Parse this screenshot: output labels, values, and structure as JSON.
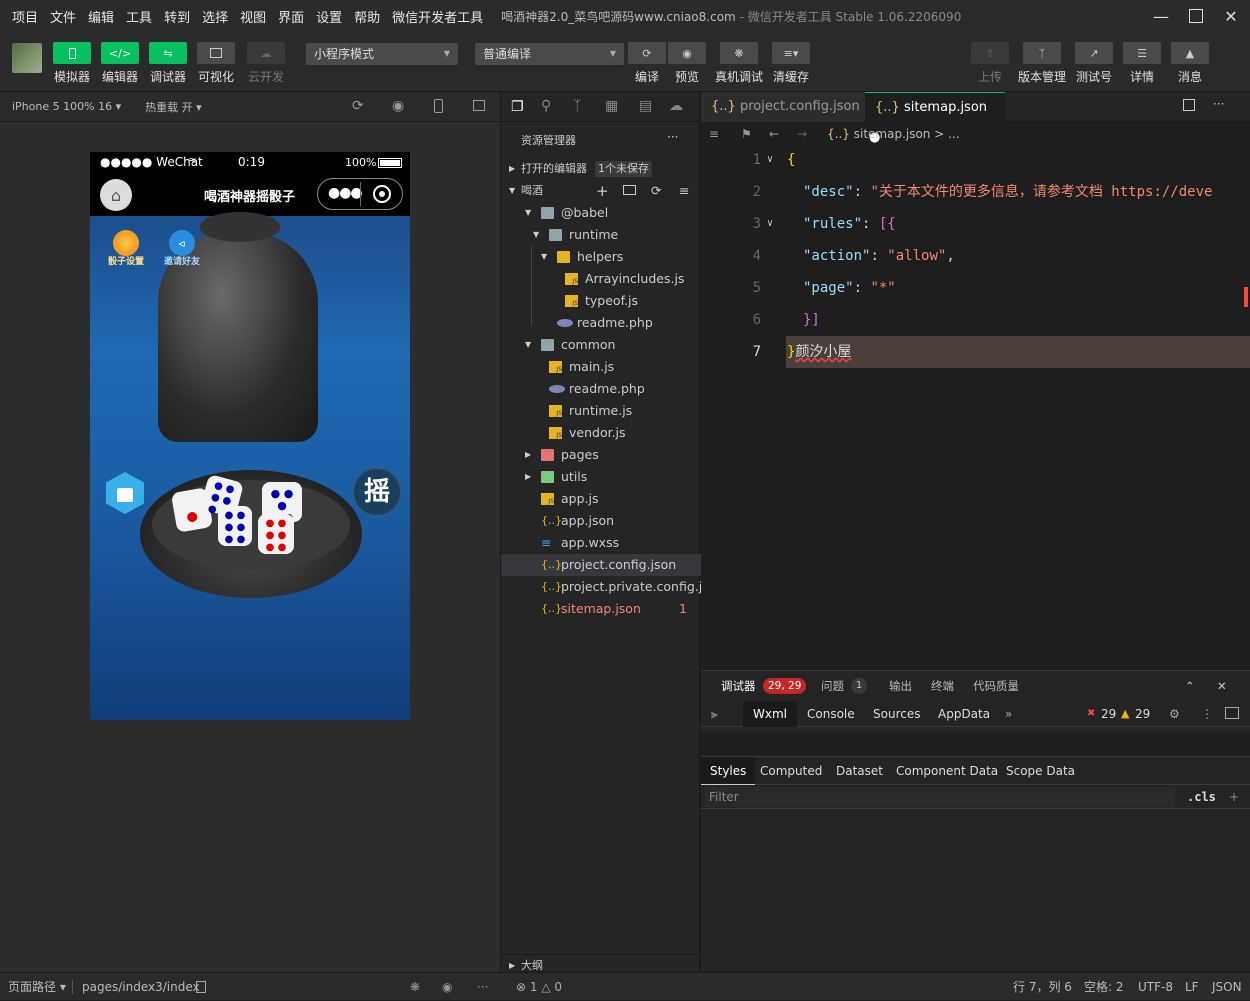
{
  "menu": [
    "项目",
    "文件",
    "编辑",
    "工具",
    "转到",
    "选择",
    "视图",
    "界面",
    "设置",
    "帮助",
    "微信开发者工具"
  ],
  "window_title": "喝酒神器2.0_菜鸟吧源码www.cniao8.com",
  "window_subtitle": "- 微信开发者工具 Stable 1.06.2206090",
  "toolbar": {
    "simulator": "模拟器",
    "editor": "编辑器",
    "debugger": "调试器",
    "visual": "可视化",
    "cloud": "云开发",
    "mode_select": "小程序模式",
    "compile_select": "普通编译",
    "compile": "编译",
    "preview": "预览",
    "real_debug": "真机调试",
    "clear_cache": "清缓存",
    "upload": "上传",
    "version": "版本管理",
    "test_id": "测试号",
    "details": "详情",
    "messages": "消息"
  },
  "sim": {
    "device": "iPhone 5 100% 16",
    "hot_reload": "热重载 开",
    "carrier": "●●●●● WeChat",
    "time": "0:19",
    "battery": "100%",
    "page_title": "喝酒神器摇骰子",
    "dice_settings": "骰子设置",
    "invite": "邀请好友",
    "shake": "摇"
  },
  "explorer": {
    "title": "资源管理器",
    "open_editors": "打开的编辑器",
    "unsaved": "1个未保存",
    "project": "喝酒",
    "outline": "大纲",
    "tree": [
      {
        "name": "@babel",
        "depth": 1,
        "kind": "folder",
        "open": true
      },
      {
        "name": "runtime",
        "depth": 2,
        "kind": "folder",
        "open": true
      },
      {
        "name": "helpers",
        "depth": 3,
        "kind": "folder-y",
        "open": true
      },
      {
        "name": "Arrayincludes.js",
        "depth": 4,
        "kind": "js"
      },
      {
        "name": "typeof.js",
        "depth": 4,
        "kind": "js"
      },
      {
        "name": "readme.php",
        "depth": 3,
        "kind": "php"
      },
      {
        "name": "common",
        "depth": 1,
        "kind": "folder",
        "open": true
      },
      {
        "name": "main.js",
        "depth": 2,
        "kind": "js"
      },
      {
        "name": "readme.php",
        "depth": 2,
        "kind": "php"
      },
      {
        "name": "runtime.js",
        "depth": 2,
        "kind": "js"
      },
      {
        "name": "vendor.js",
        "depth": 2,
        "kind": "js"
      },
      {
        "name": "pages",
        "depth": 1,
        "kind": "folder-r",
        "open": false
      },
      {
        "name": "utils",
        "depth": 1,
        "kind": "folder-g",
        "open": false
      },
      {
        "name": "app.js",
        "depth": 1,
        "kind": "js"
      },
      {
        "name": "app.json",
        "depth": 1,
        "kind": "json"
      },
      {
        "name": "app.wxss",
        "depth": 1,
        "kind": "wxss"
      },
      {
        "name": "project.config.json",
        "depth": 1,
        "kind": "json",
        "active": true
      },
      {
        "name": "project.private.config.js...",
        "depth": 1,
        "kind": "json"
      },
      {
        "name": "sitemap.json",
        "depth": 1,
        "kind": "json",
        "error": true,
        "badge": "1"
      }
    ]
  },
  "editor": {
    "tab1": "project.config.json",
    "tab2": "sitemap.json",
    "breadcrumb": "sitemap.json > ...",
    "line_numbers": [
      "1",
      "2",
      "3",
      "4",
      "5",
      "6",
      "7"
    ],
    "l1": "{",
    "l2_key": "\"desc\"",
    "l2_val": "\"关于本文件的更多信息，请参考文档 https://deve",
    "l3_key": "\"rules\"",
    "l3_rest": "[{",
    "l4_key": "\"action\"",
    "l4_val": "\"allow\"",
    "l5_key": "\"page\"",
    "l5_val": "\"*\"",
    "l6": "}]",
    "l7_brace": "}",
    "l7_text": "颜汐小屋"
  },
  "devtools": {
    "debugger": "调试器",
    "debugger_badge": "29, 29",
    "issues": "问题",
    "issues_badge": "1",
    "output": "输出",
    "terminal": "终端",
    "quality": "代码质量",
    "tabs": [
      "Wxml",
      "Console",
      "Sources",
      "AppData"
    ],
    "err_count": "29",
    "warn_count": "29",
    "subtabs": [
      "Styles",
      "Computed",
      "Dataset",
      "Component Data",
      "Scope Data"
    ],
    "filter": "Filter",
    "cls": ".cls"
  },
  "status": {
    "page_path_label": "页面路径",
    "page_path": "pages/index3/index",
    "errors": "1",
    "warnings": "0",
    "position": "行 7，列 6",
    "spaces": "空格: 2",
    "encoding": "UTF-8",
    "eol": "LF",
    "lang": "JSON"
  }
}
